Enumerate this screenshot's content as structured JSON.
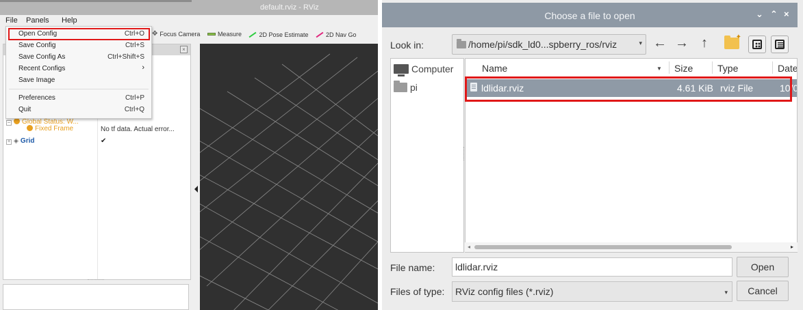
{
  "rviz": {
    "title": "default.rviz - RViz",
    "menubar": {
      "file": "File",
      "panels": "Panels",
      "help": "Help"
    },
    "toolbar": [
      {
        "label": "Focus Camera",
        "icon": "crosshair-icon"
      },
      {
        "label": "Measure",
        "icon": "ruler-icon"
      },
      {
        "label": "2D Pose Estimate",
        "icon": "green-arrow-icon"
      },
      {
        "label": "2D Nav Go",
        "icon": "pink-arrow-icon"
      }
    ],
    "file_menu": {
      "items": [
        {
          "label": "Open Config",
          "shortcut": "Ctrl+O"
        },
        {
          "label": "Save Config",
          "shortcut": "Ctrl+S"
        },
        {
          "label": "Save Config As",
          "shortcut": "Ctrl+Shift+S"
        },
        {
          "label": "Recent Configs",
          "shortcut": "›"
        },
        {
          "label": "Save Image",
          "shortcut": ""
        },
        {
          "label": "Preferences",
          "shortcut": "Ctrl+P"
        },
        {
          "label": "Quit",
          "shortcut": "Ctrl+Q"
        }
      ]
    },
    "displays": {
      "global_status": "Global Status: W...",
      "fixed_frame": "Fixed Frame",
      "fixed_frame_value": "No tf data.  Actual error...",
      "grid": "Grid",
      "grid_enabled": true
    }
  },
  "dialog": {
    "title": "Choose a file to open",
    "title_buttons": [
      "⌄",
      "⌃",
      "×"
    ],
    "look_in_label": "Look in:",
    "path": "/home/pi/sdk_ld0...spberry_ros/rviz",
    "places": [
      "Computer",
      "pi"
    ],
    "columns": [
      "Name",
      "Size",
      "Type",
      "Date"
    ],
    "files": [
      {
        "name": "ldlidar.rviz",
        "size": "4.61 KiB",
        "type": "rviz File",
        "date": "10/0"
      }
    ],
    "file_name_label": "File name:",
    "file_name_value": "ldlidar.rviz",
    "files_of_type_label": "Files of type:",
    "files_of_type_value": "RViz config files (*.rviz)",
    "open_button": "Open",
    "cancel_button": "Cancel"
  },
  "colors": {
    "highlight_red": "#e01818",
    "dialog_titlebar": "#8e99a5",
    "selected_row": "#8f9aa6",
    "viewport": "#303030",
    "status_orange": "#e8a020",
    "grid_blue": "#1e5aa8"
  }
}
